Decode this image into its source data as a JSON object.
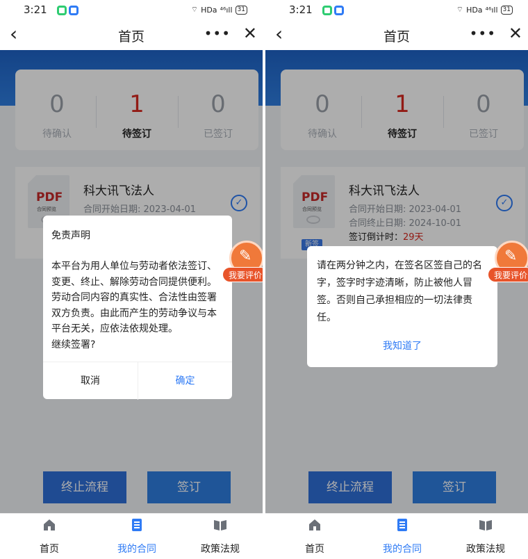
{
  "status_bar": {
    "time": "3:21",
    "right_text": "HDa",
    "signal": "⁴⁶ıll",
    "battery": "31"
  },
  "nav": {
    "back_icon": "chevron-left-icon",
    "title": "首页",
    "more": "•••",
    "close": "✕"
  },
  "stats": [
    {
      "count": "0",
      "label": "待确认"
    },
    {
      "count": "1",
      "label": "待签订"
    },
    {
      "count": "0",
      "label": "已签订"
    }
  ],
  "contract": {
    "thumb_label": "PDF",
    "thumb_sub": "合同预览",
    "title": "科大讯飞法人",
    "start_date": "合同开始日期: 2023-04-01",
    "end_date": "合同终止日期: 2024-10-01",
    "countdown_label": "签订倒计时：",
    "countdown_value": "29天",
    "tag": "新签"
  },
  "actions": {
    "stop": "终止流程",
    "sign": "签订"
  },
  "tabs": [
    {
      "label": "首页",
      "icon": "home-icon"
    },
    {
      "label": "我的合同",
      "icon": "document-icon"
    },
    {
      "label": "政策法规",
      "icon": "book-icon"
    }
  ],
  "rate_button": {
    "label": "我要评价",
    "icon": "pencil-icon"
  },
  "disclaimer_dialog": {
    "title": "免责声明",
    "body": "本平台为用人单位与劳动者依法签订、\n变更、终止、解除劳动合同提供便利。\n劳动合同内容的真实性、合法性由签署\n双方负责。由此而产生的劳动争议与本\n平台无关，应依法依规处理。\n继续签署?",
    "cancel": "取消",
    "confirm": "确定"
  },
  "notice_dialog": {
    "body": "请在两分钟之内，在签名区签自己的名\n字，签字时字迹清晰，防止被他人冒\n签。否则自己承担相应的一切法律责\n任。",
    "button": "我知道了"
  },
  "colors": {
    "accent": "#2f7bf5",
    "primary_blue": "#1e63c7",
    "alert_red": "#d8281f",
    "rate_orange": "#f0793a"
  }
}
